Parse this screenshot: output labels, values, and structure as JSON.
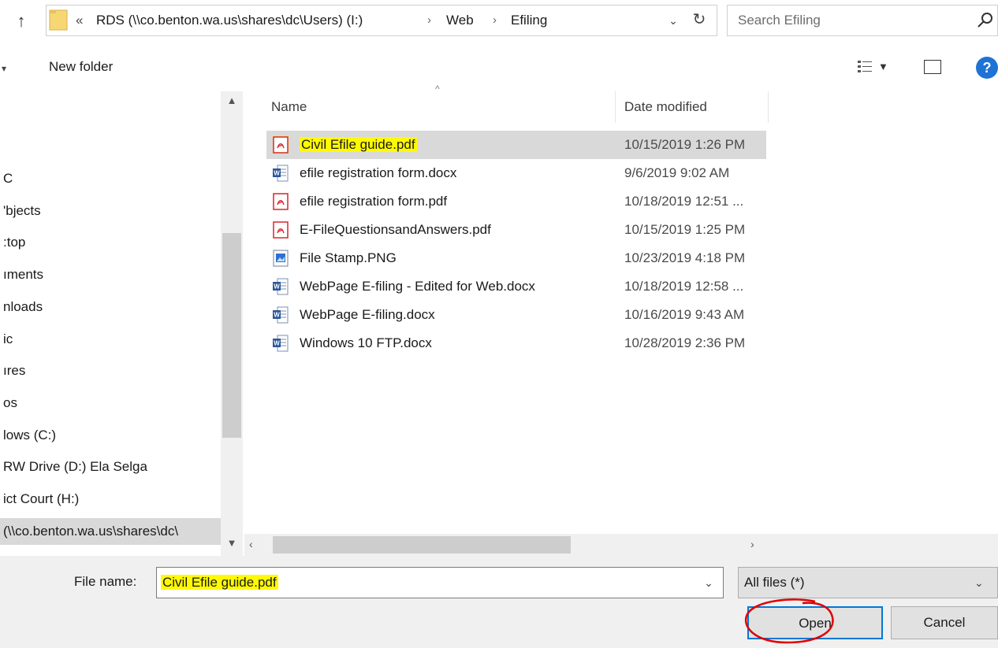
{
  "address_bar": {
    "overflow": "«",
    "crumbs": [
      "RDS (\\\\co.benton.wa.us\\shares\\dc\\Users) (I:)",
      "Web",
      "Efiling"
    ],
    "separator": "›",
    "dropdown": "⌄",
    "refresh": "↻"
  },
  "search": {
    "placeholder": "Search Efiling"
  },
  "toolbar": {
    "new_folder": "New folder",
    "help": "?"
  },
  "nav": {
    "items": [
      {
        "label": "C"
      },
      {
        "label": "'bjects"
      },
      {
        "label": ":top"
      },
      {
        "label": "ıments"
      },
      {
        "label": "nloads"
      },
      {
        "label": "ic"
      },
      {
        "label": "ıres"
      },
      {
        "label": "os"
      },
      {
        "label": "lows (C:)"
      },
      {
        "label": " RW Drive (D:) Ela Selga"
      },
      {
        "label": "ict Court (H:)"
      },
      {
        "label": "(\\\\co.benton.wa.us\\shares\\dc\\"
      }
    ]
  },
  "columns": {
    "name": "Name",
    "date": "Date modified"
  },
  "files": [
    {
      "name": "Civil Efile guide.pdf",
      "date": "10/15/2019 1:26 PM",
      "type": "pdf",
      "selected": true
    },
    {
      "name": "efile registration form.docx",
      "date": "9/6/2019 9:02 AM",
      "type": "docx"
    },
    {
      "name": "efile registration form.pdf",
      "date": "10/18/2019 12:51 ...",
      "type": "pdf"
    },
    {
      "name": "E-FileQuestionsandAnswers.pdf",
      "date": "10/15/2019 1:25 PM",
      "type": "pdf"
    },
    {
      "name": "File Stamp.PNG",
      "date": "10/23/2019 4:18 PM",
      "type": "png"
    },
    {
      "name": "WebPage E-filing - Edited for Web.docx",
      "date": "10/18/2019 12:58 ...",
      "type": "docx"
    },
    {
      "name": "WebPage E-filing.docx",
      "date": "10/16/2019 9:43 AM",
      "type": "docx"
    },
    {
      "name": "Windows 10 FTP.docx",
      "date": "10/28/2019 2:36 PM",
      "type": "docx"
    }
  ],
  "file_name": {
    "label": "File name:",
    "value": "Civil Efile guide.pdf"
  },
  "filter": {
    "value": "All files (*)"
  },
  "buttons": {
    "open": "Open",
    "cancel": "Cancel"
  },
  "colors": {
    "highlight": "#fffa00",
    "selection": "#d9d9d9",
    "annotation": "#e00000",
    "pdf": "#d8262e",
    "word": "#2b579a"
  }
}
